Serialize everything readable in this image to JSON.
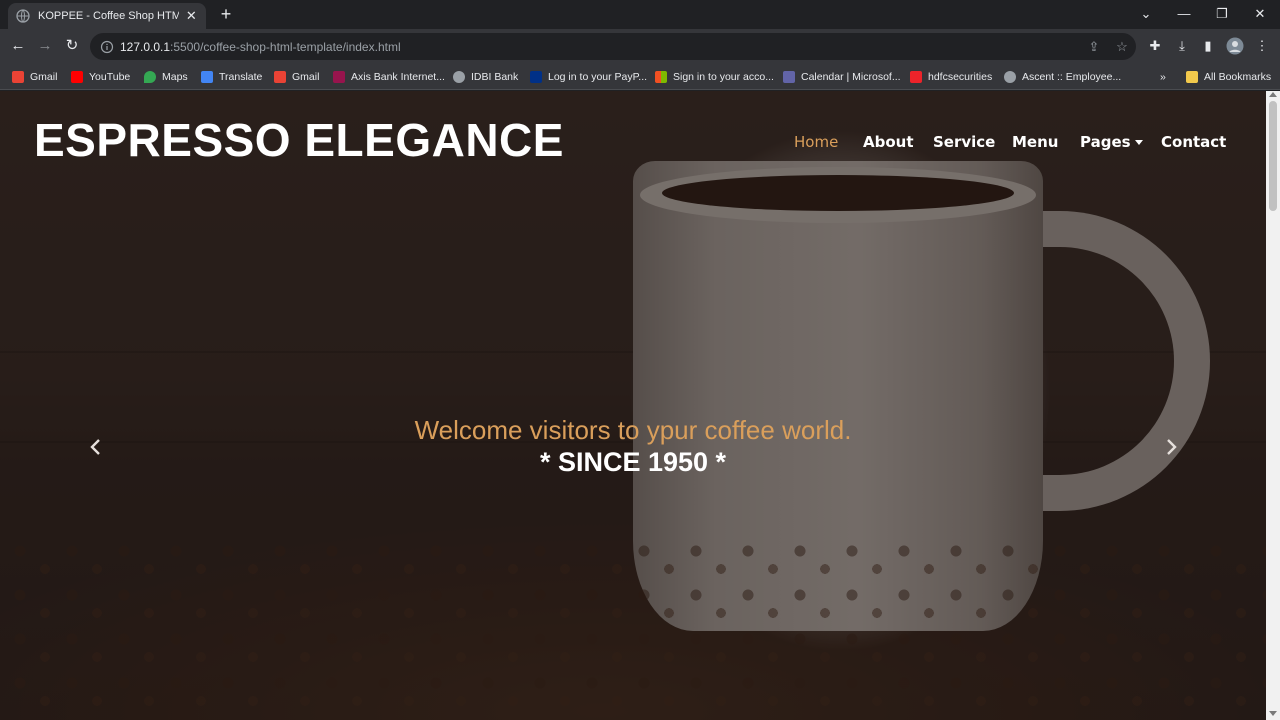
{
  "browser": {
    "tab_title": "KOPPEE - Coffee Shop HTML Tem",
    "url_host": "127.0.0.1",
    "url_rest": ":5500/coffee-shop-html-template/index.html",
    "bookmarks": [
      {
        "label": "Gmail",
        "color": "#ea4335"
      },
      {
        "label": "YouTube",
        "color": "#ff0000"
      },
      {
        "label": "Maps",
        "color": "#34a853"
      },
      {
        "label": "Translate",
        "color": "#4285f4"
      },
      {
        "label": "Gmail",
        "color": "#ea4335"
      },
      {
        "label": "Axis Bank Internet...",
        "color": "#97144d"
      },
      {
        "label": "IDBI Bank",
        "color": "#9aa0a6"
      },
      {
        "label": "Log in to your PayP...",
        "color": "#003087"
      },
      {
        "label": "Sign in to your acco...",
        "color": "#f25022"
      },
      {
        "label": "Calendar | Microsof...",
        "color": "#6264a7"
      },
      {
        "label": "hdfcsecurities",
        "color": "#ed232a"
      },
      {
        "label": "Ascent :: Employee...",
        "color": "#9aa0a6"
      }
    ],
    "overflow_label": "»",
    "all_bookmarks_label": "All Bookmarks"
  },
  "site": {
    "brand": "ESPRESSO ELEGANCE",
    "nav": {
      "home": "Home",
      "about": "About",
      "service": "Service",
      "menu": "Menu",
      "pages": "Pages",
      "contact": "Contact"
    },
    "hero": {
      "subtitle": "Welcome visitors to ypur coffee world.",
      "title": "* SINCE 1950 *"
    },
    "accent_color": "#da9f5b"
  }
}
